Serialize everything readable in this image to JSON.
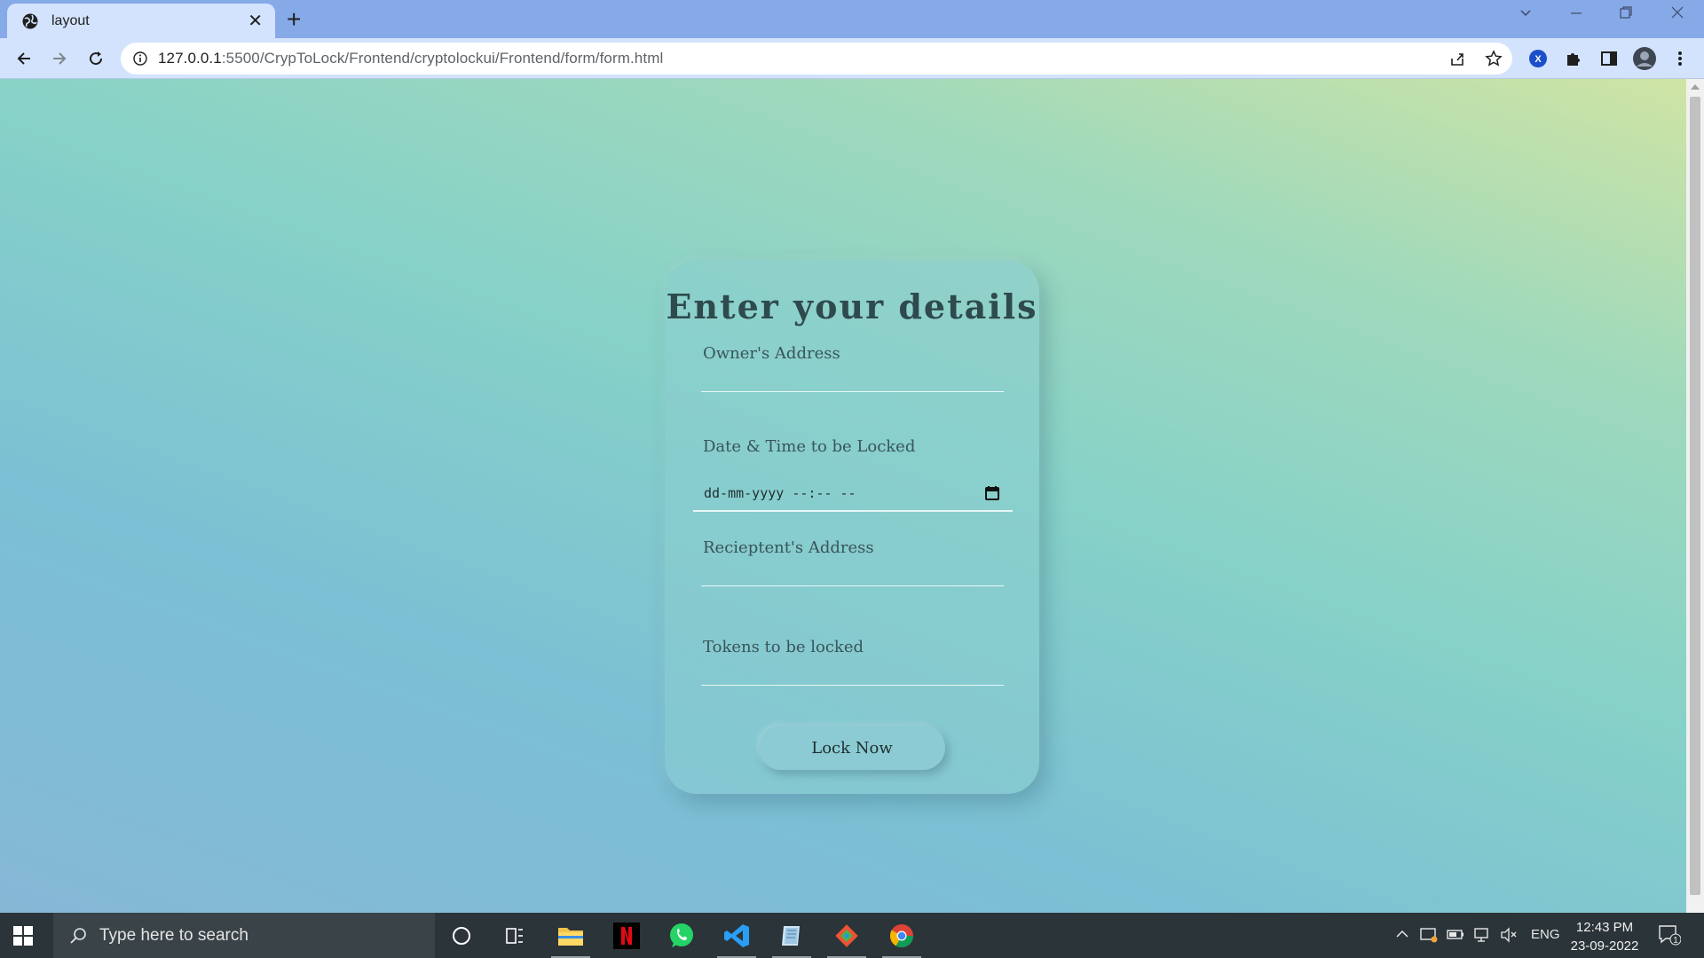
{
  "browser": {
    "tab_title": "layout",
    "url_host": "127.0.0.1",
    "url_path": ":5500/CrypToLock/Frontend/cryptolockui/Frontend/form/form.html",
    "extension_badge": "X"
  },
  "form": {
    "title": "Enter your details",
    "owner_label": "Owner's Address",
    "datetime_label": "Date & Time to be Locked",
    "datetime_placeholder": "dd-mm-yyyy --:-- --",
    "recipient_label": "Recieptent's Address",
    "tokens_label": "Tokens to be locked",
    "submit_label": "Lock Now"
  },
  "taskbar": {
    "search_placeholder": "Type here to search",
    "language": "ENG",
    "time": "12:43 PM",
    "date": "23-09-2022",
    "notification_count": "1"
  },
  "colors": {
    "card_title": "#2e4a4c",
    "field_label": "#38555a",
    "button": "#8ccbd3"
  }
}
